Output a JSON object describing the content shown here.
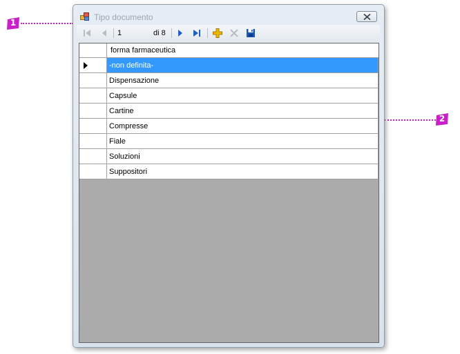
{
  "callouts": [
    {
      "number": "1"
    },
    {
      "number": "2"
    }
  ],
  "window": {
    "title": "Tipo documento"
  },
  "toolbar": {
    "position_value": "1",
    "count_label": "di 8",
    "buttons": [
      "move-first",
      "move-previous",
      "move-next",
      "move-last",
      "add-new",
      "delete",
      "save"
    ]
  },
  "grid": {
    "column_header": "forma farmaceutica",
    "selected_index": 0,
    "rows": [
      "-non definita-",
      "Dispensazione",
      "Capsule",
      "Cartine",
      "Compresse",
      "Fiale",
      "Soluzioni",
      "Suppositori"
    ]
  },
  "colors": {
    "callout": "#c81fc8",
    "selection": "#3399ff",
    "grid_background": "#ababab",
    "nav_icon": "#1a5fc9",
    "add_icon": "#f0b800"
  }
}
